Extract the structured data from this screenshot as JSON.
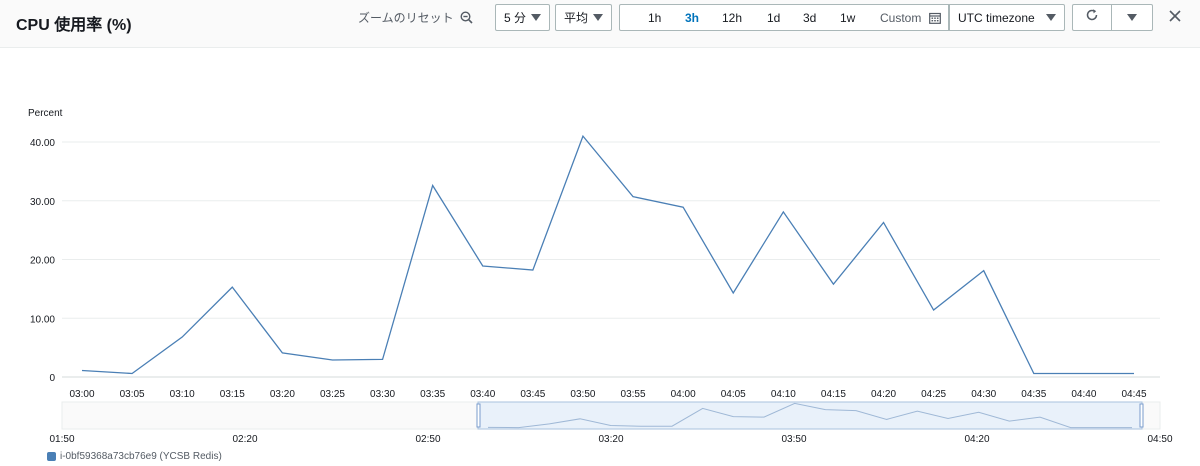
{
  "header": {
    "title": "CPU 使用率 (%)",
    "zoom_reset_label": "ズームのリセット",
    "period_value": "5 分",
    "stat_value": "平均",
    "ranges": [
      "1h",
      "3h",
      "12h",
      "1d",
      "3d",
      "1w"
    ],
    "active_range": "3h",
    "custom_label": "Custom",
    "timezone_value": "UTC timezone"
  },
  "colors": {
    "series": "#4a7fb5",
    "active": "#0073bb",
    "grid": "#eaeded",
    "minimap_window": "#e9f1fa"
  },
  "chart_data": {
    "type": "line",
    "ylabel": "Percent",
    "ylim": [
      0,
      40
    ],
    "yticks": [
      "0",
      "10.00",
      "20.00",
      "30.00",
      "40.00"
    ],
    "categories": [
      "03:00",
      "03:05",
      "03:10",
      "03:15",
      "03:20",
      "03:25",
      "03:30",
      "03:35",
      "03:40",
      "03:45",
      "03:50",
      "03:55",
      "04:00",
      "04:05",
      "04:10",
      "04:15",
      "04:20",
      "04:25",
      "04:30",
      "04:35",
      "04:40",
      "04:45"
    ],
    "series": [
      {
        "name": "i-0bf59368a73cb76e9 (YCSB Redis)",
        "values": [
          1.1,
          0.6,
          6.8,
          15.3,
          4.1,
          2.9,
          3.0,
          32.6,
          18.9,
          18.2,
          41.0,
          30.7,
          28.9,
          14.3,
          28.1,
          15.8,
          26.3,
          11.4,
          18.1,
          0.6,
          0.6,
          0.6
        ]
      }
    ],
    "grid": true,
    "legend": "bottom-left"
  },
  "minimap": {
    "ticks": [
      "01:50",
      "02:20",
      "02:50",
      "03:20",
      "03:50",
      "04:20",
      "04:50"
    ]
  }
}
